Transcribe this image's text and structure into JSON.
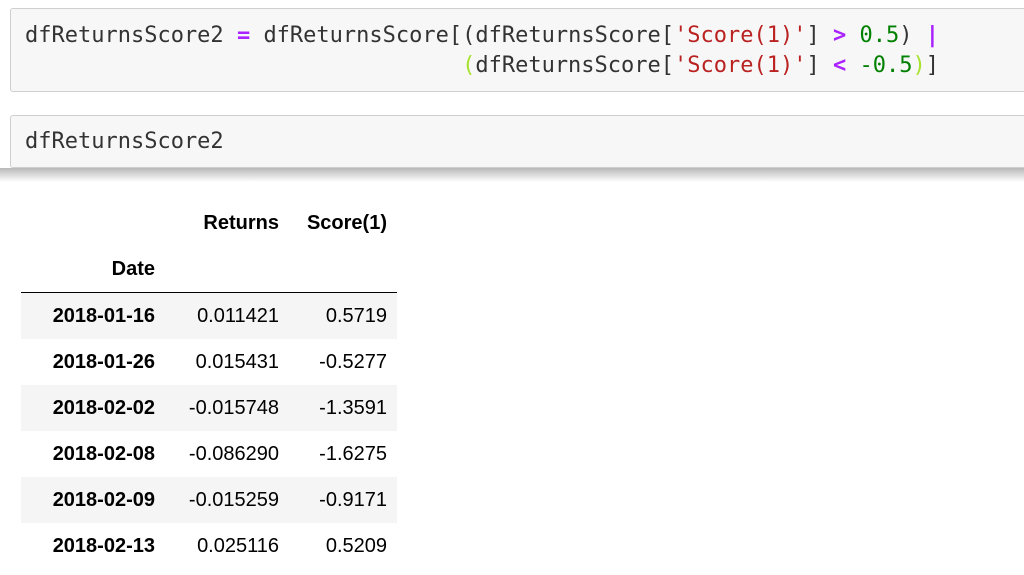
{
  "code_cell_1": {
    "line1": {
      "lhs": "dfReturnsScore2",
      "eq": "=",
      "df": "dfReturnsScore",
      "open": "[(",
      "df2": "dfReturnsScore",
      "key_open": "[",
      "key": "'Score(1)'",
      "key_close": "]",
      "op": ">",
      "num": "0.5",
      "close": ")",
      "pipe": "|"
    },
    "line2": {
      "open": "(",
      "df": "dfReturnsScore",
      "key_open": "[",
      "key": "'Score(1)'",
      "key_close": "]",
      "op": "<",
      "num": "-0.5",
      "close": ")",
      "bracket_close": "]"
    }
  },
  "code_cell_2": {
    "text": "dfReturnsScore2"
  },
  "output_table": {
    "columns": [
      "Returns",
      "Score(1)"
    ],
    "index_name": "Date",
    "rows": [
      {
        "date": "2018-01-16",
        "returns": "0.011421",
        "score": "0.5719"
      },
      {
        "date": "2018-01-26",
        "returns": "0.015431",
        "score": "-0.5277"
      },
      {
        "date": "2018-02-02",
        "returns": "-0.015748",
        "score": "-1.3591"
      },
      {
        "date": "2018-02-08",
        "returns": "-0.086290",
        "score": "-1.6275"
      },
      {
        "date": "2018-02-09",
        "returns": "-0.015259",
        "score": "-0.9171"
      },
      {
        "date": "2018-02-13",
        "returns": "0.025116",
        "score": "0.5209"
      }
    ]
  },
  "colors": {
    "cell_background": "#f7f7f7",
    "cell_border": "#cfcfcf",
    "code_text": "#333333",
    "operator": "#aa22ff",
    "string": "#ba2121",
    "number": "#008000",
    "row_stripe": "#f5f5f5"
  }
}
